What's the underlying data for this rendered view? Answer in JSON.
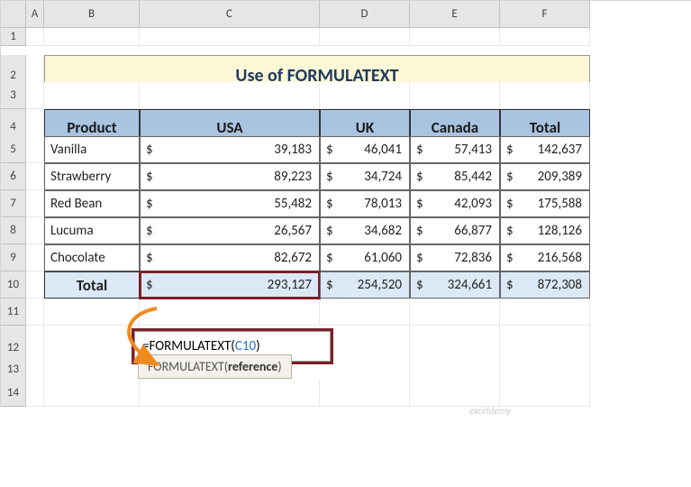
{
  "columns": [
    "A",
    "B",
    "C",
    "D",
    "E",
    "F"
  ],
  "rows": [
    "1",
    "2",
    "3",
    "4",
    "5",
    "6",
    "7",
    "8",
    "9",
    "10",
    "11",
    "12",
    "13",
    "14"
  ],
  "title": "Use of FORMULATEXT",
  "headers": {
    "product": "Product",
    "usa": "USA",
    "uk": "UK",
    "canada": "Canada",
    "total": "Total"
  },
  "products": [
    {
      "name": "Vanilla",
      "usa": "39,183",
      "uk": "46,041",
      "canada": "57,413",
      "total": "142,637"
    },
    {
      "name": "Strawberry",
      "usa": "89,223",
      "uk": "34,724",
      "canada": "85,442",
      "total": "209,389"
    },
    {
      "name": "Red Bean",
      "usa": "55,482",
      "uk": "78,013",
      "canada": "42,093",
      "total": "175,588"
    },
    {
      "name": "Lucuma",
      "usa": "26,567",
      "uk": "34,682",
      "canada": "66,877",
      "total": "128,126"
    },
    {
      "name": "Chocolate",
      "usa": "82,672",
      "uk": "61,060",
      "canada": "72,836",
      "total": "216,568"
    }
  ],
  "totals_label": "Total",
  "totals": {
    "usa": "293,127",
    "uk": "254,520",
    "canada": "324,661",
    "total": "872,308"
  },
  "currency": "$",
  "formula_prefix": "=FORMULATEXT(",
  "formula_ref": "C10",
  "formula_suffix": ")",
  "tooltip_fn": "FORMULATEXT(",
  "tooltip_arg": "reference",
  "tooltip_close": ")",
  "watermark": "exceldemy"
}
